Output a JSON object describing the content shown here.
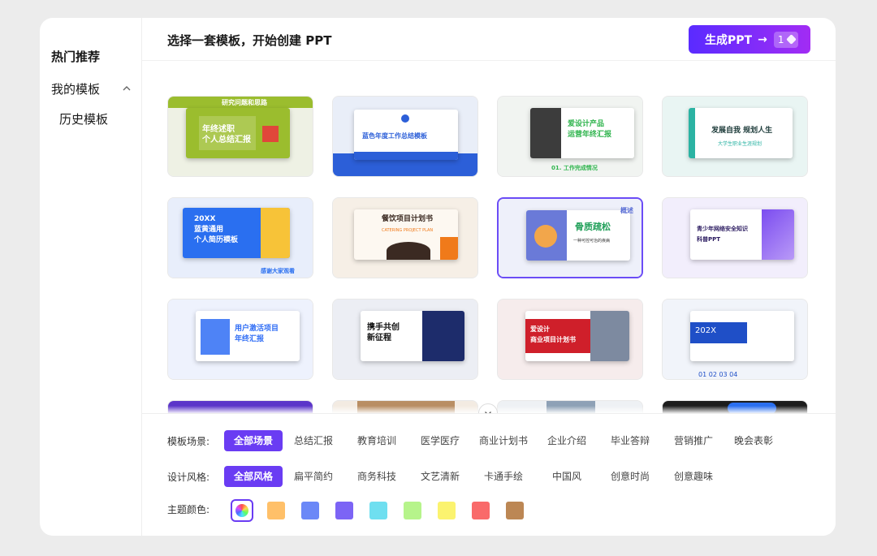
{
  "sidebar": {
    "hot": "热门推荐",
    "mine": "我的模板",
    "history": "历史模板"
  },
  "header": {
    "title": "选择一套模板，开始创建 PPT",
    "generate_label": "生成PPT",
    "generate_arrow": "→",
    "generate_count": "1"
  },
  "templates": [
    {
      "title": "年终述职\n个人总结汇报",
      "banner": "研究问题和思路",
      "accent": "#9bbd2e"
    },
    {
      "title": "蓝色年度工作总结模板",
      "accent": "#2c5fd8"
    },
    {
      "title": "爱设计产品\n运营年终汇报",
      "footer": "01. 工作完成情况",
      "accent": "#2fb44d"
    },
    {
      "title": "发展自我 规划人生",
      "subtitle": "大学生职业生涯规划",
      "accent": "#2bb3a3"
    },
    {
      "title": "20XX\n蓝黄通用\n个人简历模板",
      "footer": "感谢大家观看",
      "accent": "#2a6ff0"
    },
    {
      "title": "餐饮项目计划书",
      "subtitle": "CATERING PROJECT PLAN",
      "accent": "#f07a1a"
    },
    {
      "title": "骨质疏松",
      "subtitle": "一种可控可治的疾病",
      "tag": "概述",
      "accent": "#5b6fd6"
    },
    {
      "title": "青少年网络安全知识\n科普PPT",
      "accent": "#7b4cf0"
    },
    {
      "title": "用户激活项目\n年终汇报",
      "accent": "#2f6df5"
    },
    {
      "title": "携手共创\n新征程",
      "accent": "#1d2c6b"
    },
    {
      "title": "爱设计\n商业项目计划书",
      "accent": "#cf1f2a"
    },
    {
      "title": "202X",
      "footer": "01 02 03 04",
      "accent": "#1f4fc7"
    },
    {
      "accent": "#5b35c9"
    },
    {
      "accent": "#b98e63"
    },
    {
      "accent": "#8ea1b6"
    },
    {
      "accent": "#1c1c1c"
    }
  ],
  "filters": {
    "scene_label": "模板场景:",
    "scenes": [
      "全部场景",
      "总结汇报",
      "教育培训",
      "医学医疗",
      "商业计划书",
      "企业介绍",
      "毕业答辩",
      "营销推广",
      "晚会表彰"
    ],
    "style_label": "设计风格:",
    "styles": [
      "全部风格",
      "扁平简约",
      "商务科技",
      "文艺清新",
      "卡通手绘",
      "中国风",
      "创意时尚",
      "创意趣味"
    ],
    "color_label": "主题颜色:",
    "colors": [
      "#ffc069",
      "#6b88f7",
      "#7c64f5",
      "#6fdff0",
      "#b6f48b",
      "#fbf36f",
      "#f96a6a",
      "#bc8754"
    ]
  }
}
